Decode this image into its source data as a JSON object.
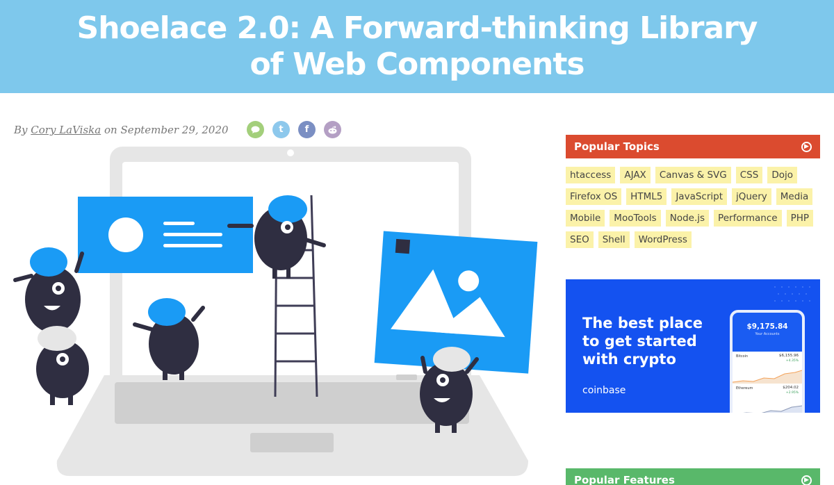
{
  "article": {
    "title": "Shoelace 2.0: A Forward-thinking Library of Web Components",
    "byline_prefix": "By",
    "author": "Cory LaViska",
    "byline_on": "on",
    "date": "September 29, 2020"
  },
  "share": {
    "comments_icon": "comment-icon",
    "twitter_icon": "twitter-icon",
    "facebook_icon": "facebook-icon",
    "reddit_icon": "reddit-icon",
    "twitter_glyph": "t",
    "facebook_glyph": "f",
    "colors": {
      "comments": "#a3cf7b",
      "twitter": "#8dc8ec",
      "facebook": "#7b8fc3",
      "reddit": "#b49fc4"
    }
  },
  "sidebar": {
    "popular_topics": {
      "title": "Popular Topics",
      "color": "#db4b2f",
      "tags": [
        "htaccess",
        "AJAX",
        "Canvas & SVG",
        "CSS",
        "Dojo",
        "Firefox OS",
        "HTML5",
        "JavaScript",
        "jQuery",
        "Media",
        "Mobile",
        "MooTools",
        "Node.js",
        "Performance",
        "PHP",
        "SEO",
        "Shell",
        "WordPress"
      ]
    },
    "ad": {
      "headline": "The best place to get started with crypto",
      "brand": "coinbase",
      "phone_balance": "$9,175.84",
      "phone_subtitle": "Your Accounts",
      "rows": [
        {
          "name": "Bitcoin",
          "price": "$6,155.96",
          "pct": "+4.35%"
        },
        {
          "name": "Ethereum",
          "price": "$204.02",
          "pct": "+2.95%"
        }
      ],
      "color": "#1452f0"
    },
    "popular_features": {
      "title": "Popular Features",
      "color": "#59b86a"
    }
  },
  "colors": {
    "header_bg": "#7ec8ec",
    "illustration_blue": "#1a9bf5",
    "creature_dark": "#2f2e41",
    "laptop_gray": "#e6e6e6"
  }
}
